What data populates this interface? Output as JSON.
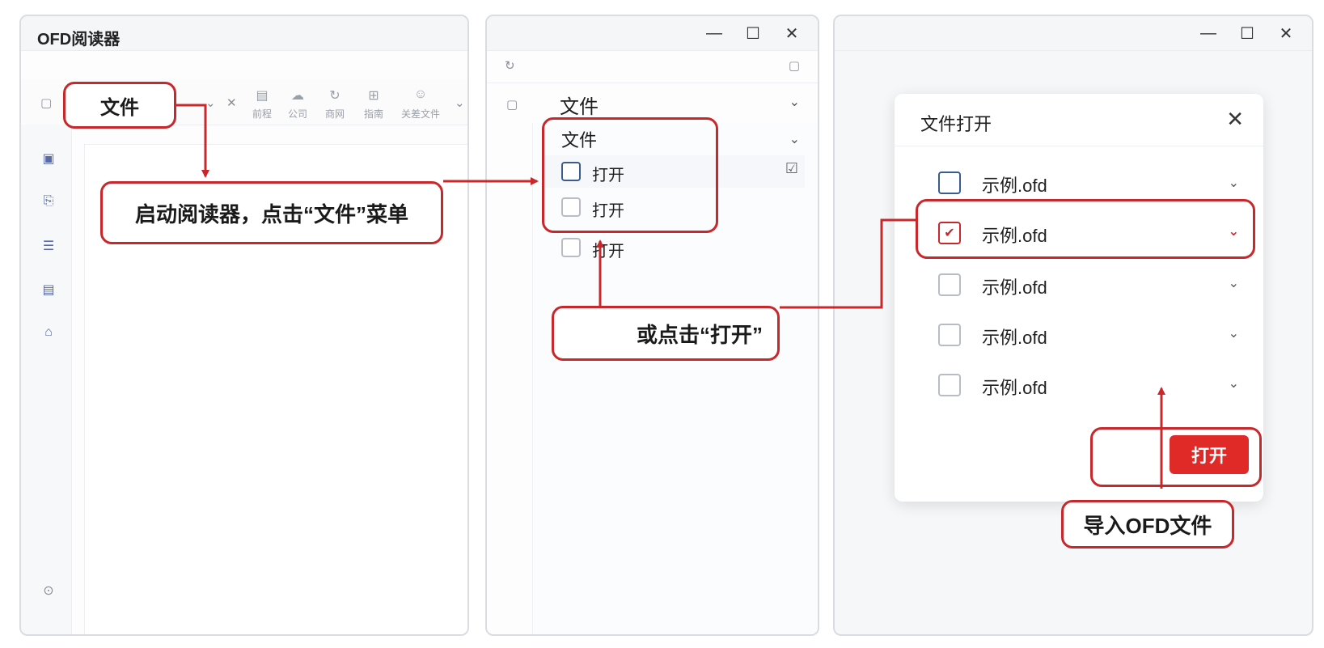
{
  "panel1": {
    "title": "OFD阅读器",
    "tools": [
      {
        "icon": "close-icon",
        "label": ""
      },
      {
        "icon": "calendar-icon",
        "label": "前程"
      },
      {
        "icon": "cloud-icon",
        "label": "公司"
      },
      {
        "icon": "refresh-icon",
        "label": "商网"
      },
      {
        "icon": "grid-icon",
        "label": "指南"
      },
      {
        "icon": "smile-icon",
        "label": "关差文件"
      }
    ],
    "file_label": "文件",
    "callout": "启动阅读器，点击“文件”菜单"
  },
  "panel2": {
    "file_menu_label": "文件",
    "dropdown_label": "文件",
    "open_items": [
      "打开",
      "打开",
      "打开"
    ],
    "callout": "或点击“打开”"
  },
  "panel3": {
    "dialog_title": "文件打开",
    "files": [
      {
        "name": "示例.ofd",
        "checked": false
      },
      {
        "name": "示例.ofd",
        "checked": true
      },
      {
        "name": "示例.ofd",
        "checked": false
      },
      {
        "name": "示例.ofd",
        "checked": false
      },
      {
        "name": "示例.ofd",
        "checked": false
      }
    ],
    "open_button": "打开",
    "callout": "导入OFD文件"
  },
  "window_buttons": {
    "minimize": "—",
    "maximize": "☐",
    "close": "✕"
  },
  "colors": {
    "accent": "#c8282c",
    "button": "#e02a28"
  }
}
